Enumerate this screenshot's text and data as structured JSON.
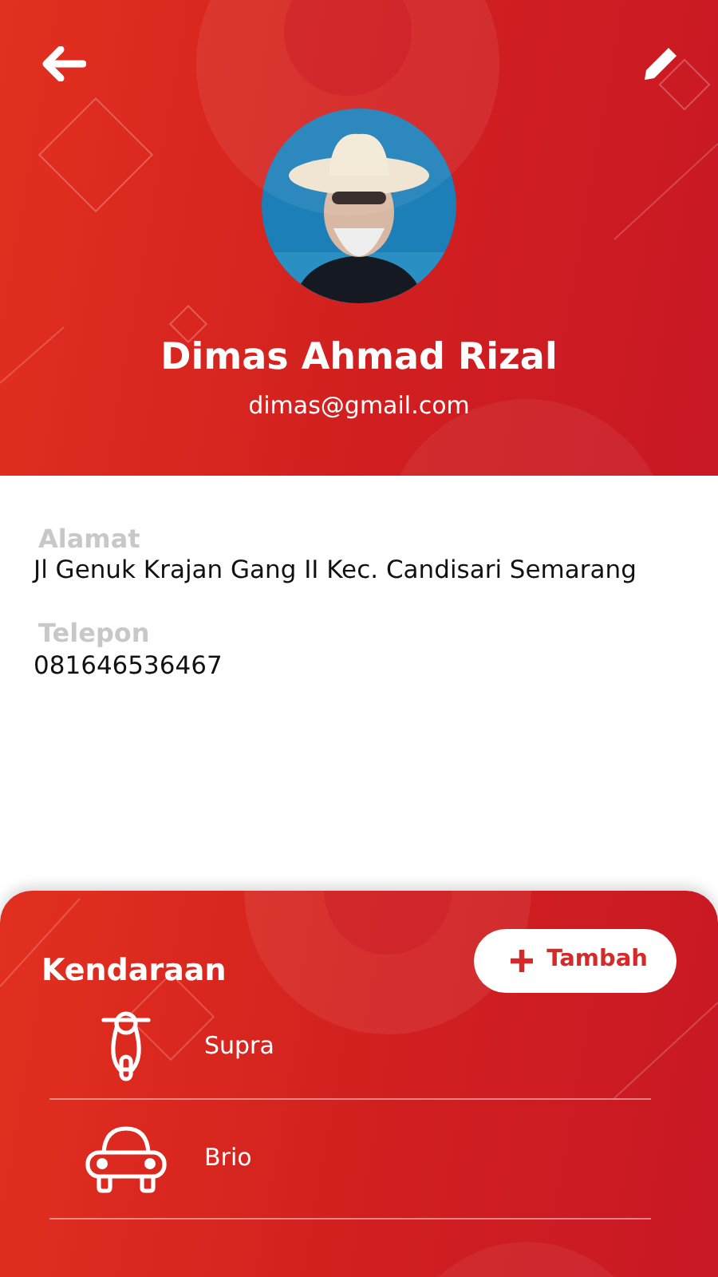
{
  "profile": {
    "name": "Dimas Ahmad Rizal",
    "email": "dimas@gmail.com"
  },
  "details": [
    {
      "label": "Alamat",
      "value": "Jl Genuk Krajan Gang II Kec. Candisari Semarang"
    },
    {
      "label": "Telepon",
      "value": "081646536467"
    }
  ],
  "vehicles": {
    "title": "Kendaraan",
    "add_button": "Tambah",
    "items": [
      {
        "kind": "motorcycle",
        "name": "Supra"
      },
      {
        "kind": "car",
        "name": "Brio"
      }
    ]
  }
}
